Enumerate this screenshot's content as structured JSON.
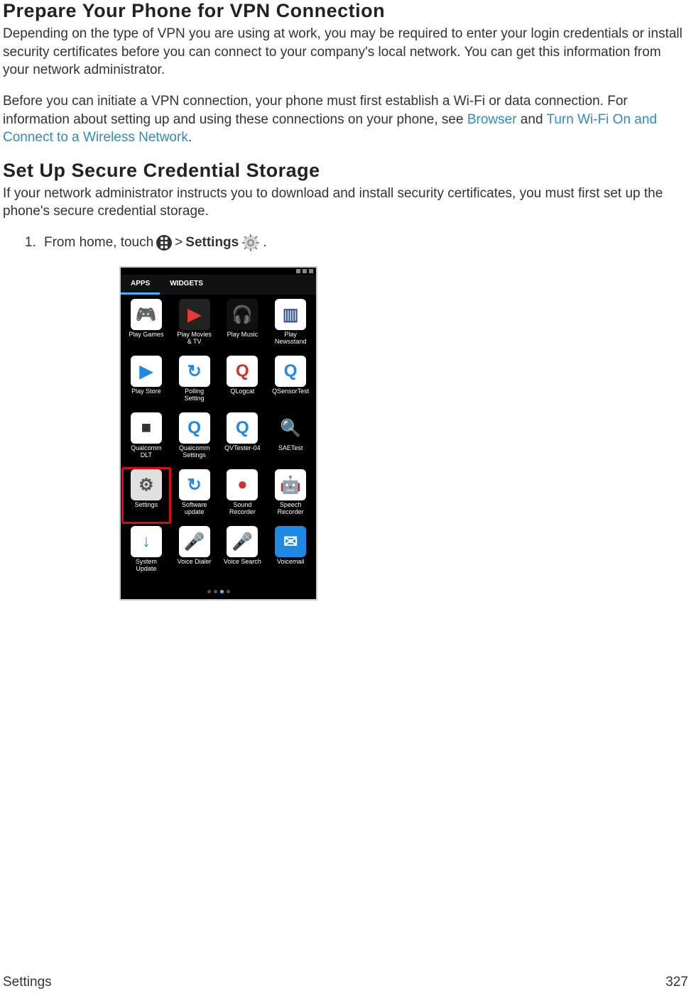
{
  "section1": {
    "title": "Prepare Your Phone for VPN Connection",
    "para1": "Depending on the type of VPN you are using at work, you may be required to enter your login credentials or install security certificates before you can connect to your company's local network. You can get this information from your network administrator.",
    "para2_pre": "Before you can initiate a VPN connection, your phone must first establish a Wi-Fi or data connection. For information about setting up and using these connections on your phone, see ",
    "link_browser": "Browser",
    "para2_mid": " and ",
    "link_wifi": "Turn Wi-Fi On and Connect to a Wireless Network",
    "para2_post": "."
  },
  "section2": {
    "title": "Set Up Secure Credential Storage",
    "para1": "If your network administrator instructs you to download and install security certificates, you must first set up the phone's secure credential storage.",
    "step1_pre": "From home, touch ",
    "step1_gt": " > ",
    "step1_settings": "Settings",
    "step1_post": " ."
  },
  "phone": {
    "tabs": {
      "apps": "APPS",
      "widgets": "WIDGETS"
    },
    "apps": [
      {
        "label": "Play Games",
        "bg": "#fff",
        "sym": "🎮",
        "fg": "#2e7d32",
        "hl": false
      },
      {
        "label": "Play Movies\n& TV",
        "bg": "#222",
        "sym": "▶",
        "fg": "#e53935",
        "hl": false
      },
      {
        "label": "Play Music",
        "bg": "#111",
        "sym": "🎧",
        "fg": "#ff9800",
        "hl": false
      },
      {
        "label": "Play\nNewsstand",
        "bg": "#fff",
        "sym": "▥",
        "fg": "#3b5998",
        "hl": false
      },
      {
        "label": "Play Store",
        "bg": "#fff",
        "sym": "▶",
        "fg": "#1e88e5",
        "hl": false
      },
      {
        "label": "Polling\nSetting",
        "bg": "#fff",
        "sym": "↻",
        "fg": "#1e88e5",
        "hl": false
      },
      {
        "label": "QLogcat",
        "bg": "#fff",
        "sym": "Q",
        "fg": "#d32f2f",
        "hl": false
      },
      {
        "label": "QSensorTest",
        "bg": "#fff",
        "sym": "Q",
        "fg": "#1e88e5",
        "hl": false
      },
      {
        "label": "Qualcomm\nDLT",
        "bg": "#fff",
        "sym": "■",
        "fg": "#333333",
        "hl": false
      },
      {
        "label": "Qualcomm\nSettings",
        "bg": "#fff",
        "sym": "Q",
        "fg": "#1e88e5",
        "hl": false
      },
      {
        "label": "QVTester-04",
        "bg": "#fff",
        "sym": "Q",
        "fg": "#1e88e5",
        "hl": false
      },
      {
        "label": "SAETest",
        "bg": "#000",
        "sym": "🔍",
        "fg": "#2196f3",
        "hl": false
      },
      {
        "label": "Settings",
        "bg": "#e0e0e0",
        "sym": "⚙",
        "fg": "#555555",
        "hl": true
      },
      {
        "label": "Software\nupdate",
        "bg": "#fff",
        "sym": "↻",
        "fg": "#1e88e5",
        "hl": false
      },
      {
        "label": "Sound\nRecorder",
        "bg": "#fff",
        "sym": "●",
        "fg": "#d32f2f",
        "hl": false
      },
      {
        "label": "Speech\nRecorder",
        "bg": "#fff",
        "sym": "🤖",
        "fg": "#8bc34a",
        "hl": false
      },
      {
        "label": "System\nUpdate",
        "bg": "#fff",
        "sym": "↓",
        "fg": "#1e88e5",
        "hl": false
      },
      {
        "label": "Voice Dialer",
        "bg": "#fff",
        "sym": "🎤",
        "fg": "#1e88e5",
        "hl": false
      },
      {
        "label": "Voice Search",
        "bg": "#fff",
        "sym": "🎤",
        "fg": "#d32f2f",
        "hl": false
      },
      {
        "label": "Voicemail",
        "bg": "#1e88e5",
        "sym": "✉",
        "fg": "#ffffff",
        "hl": false
      }
    ]
  },
  "footer": {
    "section": "Settings",
    "page": "327"
  }
}
